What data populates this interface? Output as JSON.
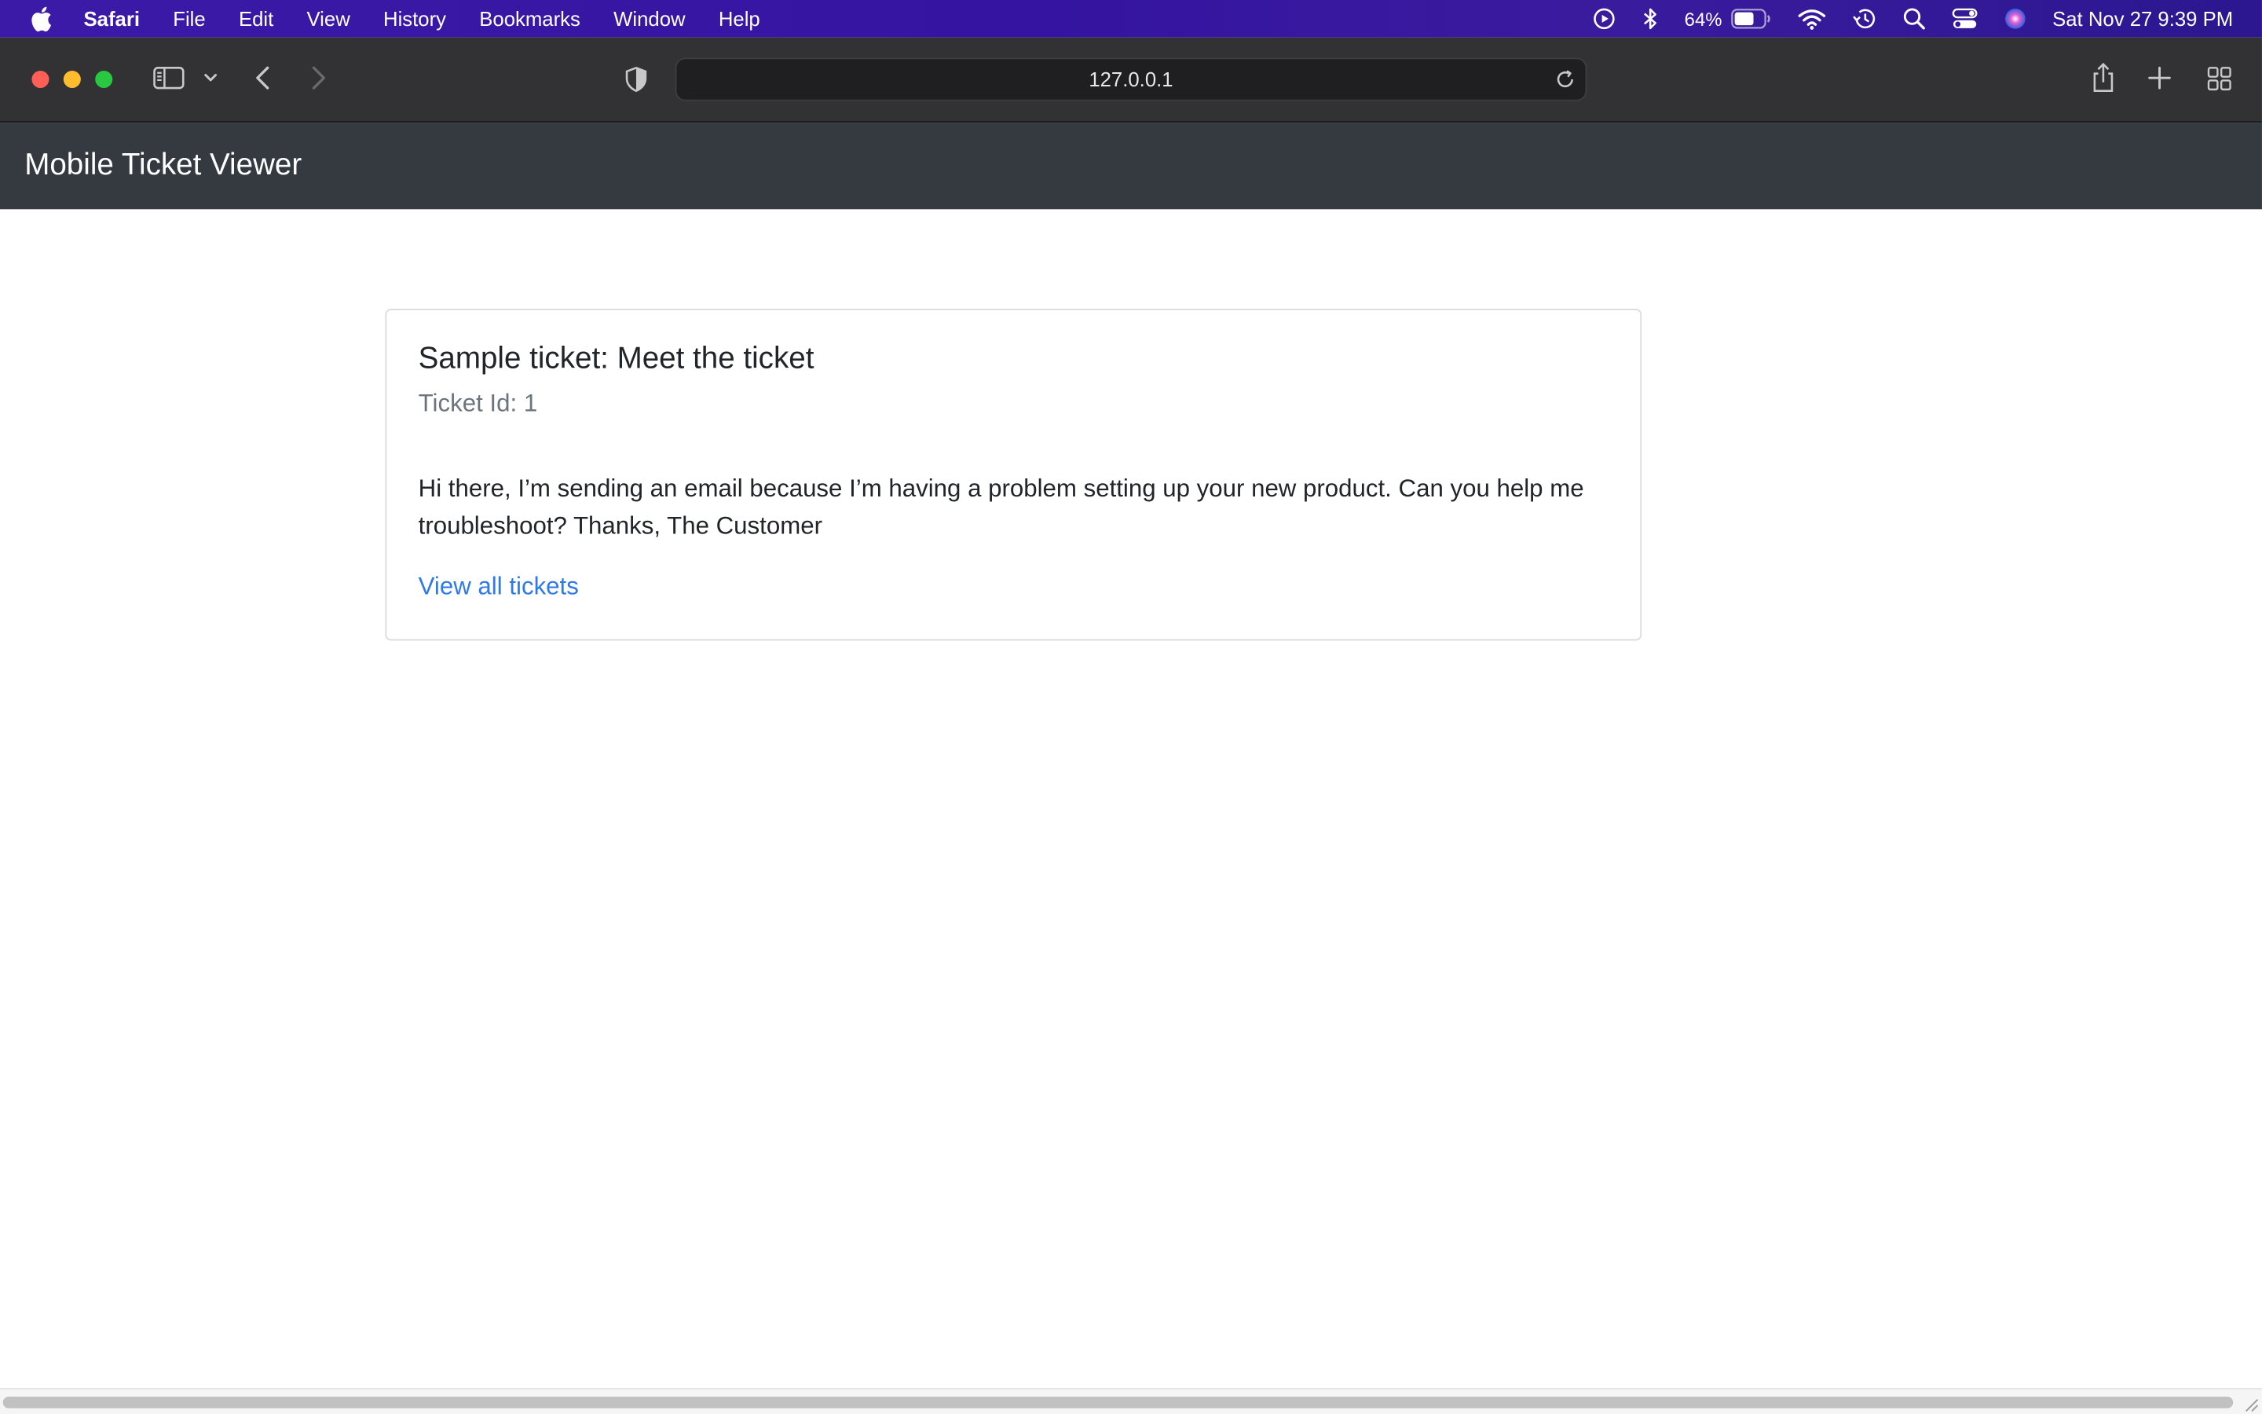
{
  "menubar": {
    "app_name": "Safari",
    "items": [
      "File",
      "Edit",
      "View",
      "History",
      "Bookmarks",
      "Window",
      "Help"
    ],
    "battery_percent": "64%",
    "clock": "Sat Nov 27  9:39 PM",
    "icons": [
      "apple-icon",
      "play-circle-icon",
      "bluetooth-icon",
      "battery-icon",
      "wifi-icon",
      "time-machine-icon",
      "spotlight-search-icon",
      "control-center-icon",
      "siri-icon"
    ]
  },
  "toolbar": {
    "url": "127.0.0.1",
    "icons": [
      "sidebar-icon",
      "chevron-down-icon",
      "back-icon",
      "forward-icon",
      "privacy-shield-icon",
      "reload-icon",
      "share-icon",
      "new-tab-icon",
      "tab-overview-icon"
    ]
  },
  "navbar": {
    "brand": "Mobile Ticket Viewer"
  },
  "ticket": {
    "title": "Sample ticket: Meet the ticket",
    "subtitle": "Ticket Id: 1",
    "body": "Hi there, I’m sending an email because I’m having a problem setting up your new product. Can you help me troubleshoot? Thanks, The Customer",
    "link_label": "View all tickets"
  },
  "colors": {
    "menubar": "#3414a0",
    "toolbar": "#323234",
    "navbar": "#343a40",
    "link": "#2f79e8",
    "muted": "#6c757d"
  }
}
